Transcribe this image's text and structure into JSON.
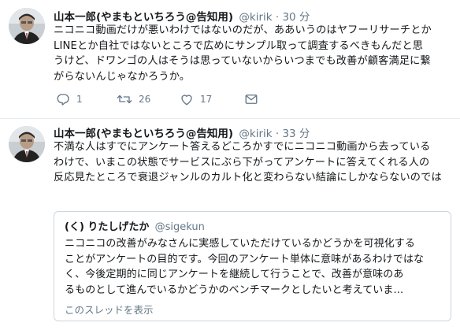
{
  "tweets": [
    {
      "name": "山本一郎(やまもといちろう@告知用)",
      "handle": "@kirik",
      "separator": "·",
      "time": "30 分",
      "lines": [
        "ニコニコ動画だけが悪いわけではないのだが、ああいうのはヤフーリサーチとか",
        "LINEとか自社ではないところで広めにサンプル取って調査するべきもんだと思",
        "うけど、ドワンゴの人はそうは思っていないからいつまでも改善が顧客満足に繋",
        "がらないんじゃなかろうか。"
      ],
      "actions": {
        "reply_count": "1",
        "retweet_count": "26",
        "like_count": "17",
        "reply_icon": "reply-icon",
        "retweet_icon": "retweet-icon",
        "like_icon": "heart-icon",
        "dm_icon": "envelope-icon"
      }
    },
    {
      "name": "山本一郎(やまもといちろう@告知用)",
      "handle": "@kirik",
      "separator": "·",
      "time": "33 分",
      "lines": [
        "不満な人はすでにアンケート答えるどころかすでにニコニコ動画から去っている",
        "わけで、いまこの状態でサービスにぶら下がってアンケートに答えてくれる人の",
        "反応見たところで衰退ジャンルのカルト化と変わらない結論にしかならないのでは"
      ],
      "quote": {
        "name": "(く) りたしげたか",
        "handle": "@sigekun",
        "lines": [
          "ニコニコの改善がみなさんに実感していただけているかどうかを可視化する",
          "ことがアンケートの目的です。今回のアンケート単体に意味があるわけではな",
          "く、今後定期的に同じアンケートを継続して行うことで、改善が意味のあ",
          "るものとして進んでいるかどうかのベンチマークとしたいと考えていま..."
        ],
        "thread_link": "このスレッドを表示"
      }
    }
  ],
  "colors": {
    "text": "#14171a",
    "muted": "#657786",
    "border": "#e6ecf0",
    "quote_border": "#ccd6dd"
  }
}
